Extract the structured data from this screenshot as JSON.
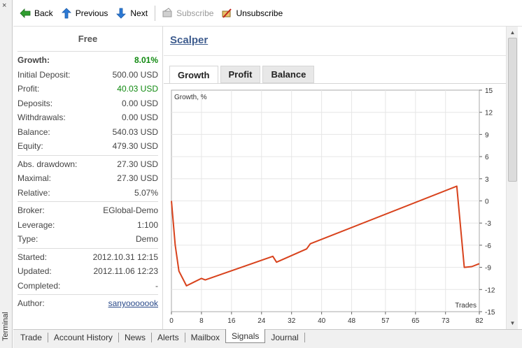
{
  "window": {
    "side_label": "Terminal",
    "close_glyph": "×"
  },
  "toolbar": {
    "back": "Back",
    "previous": "Previous",
    "next": "Next",
    "subscribe": "Subscribe",
    "unsubscribe": "Unsubscribe"
  },
  "stats": {
    "header": "Free",
    "groups": [
      [
        {
          "label": "Growth:",
          "value": "8.01%"
        },
        {
          "label": "Initial Deposit:",
          "value": "500.00 USD"
        },
        {
          "label": "Profit:",
          "value": "40.03 USD"
        },
        {
          "label": "Deposits:",
          "value": "0.00 USD"
        },
        {
          "label": "Withdrawals:",
          "value": "0.00 USD"
        },
        {
          "label": "Balance:",
          "value": "540.03 USD"
        },
        {
          "label": "Equity:",
          "value": "479.30 USD"
        }
      ],
      [
        {
          "label": "Abs. drawdown:",
          "value": "27.30 USD"
        },
        {
          "label": "Maximal:",
          "value": "27.30 USD"
        },
        {
          "label": "Relative:",
          "value": "5.07%"
        }
      ],
      [
        {
          "label": "Broker:",
          "value": "EGlobal-Demo"
        },
        {
          "label": "Leverage:",
          "value": "1:100"
        },
        {
          "label": "Type:",
          "value": "Demo"
        }
      ],
      [
        {
          "label": "Started:",
          "value": "2012.10.31 12:15"
        },
        {
          "label": "Updated:",
          "value": "2012.11.06 12:23"
        },
        {
          "label": "Completed:",
          "value": "-"
        }
      ],
      [
        {
          "label": "Author:",
          "value": "sanyooooook"
        }
      ]
    ]
  },
  "signal": {
    "title": "Scalper"
  },
  "tabs": [
    "Growth",
    "Profit",
    "Balance"
  ],
  "bottom_tabs": [
    "Trade",
    "Account History",
    "News",
    "Alerts",
    "Mailbox",
    "Signals",
    "Journal"
  ],
  "colors": {
    "line": "#d8421c",
    "positive": "#118a11",
    "link": "#3e5c8e"
  },
  "chart_data": {
    "type": "line",
    "title": "Growth, %",
    "xlabel": "Trades",
    "ylabel": "",
    "xlim": [
      0,
      82
    ],
    "ylim": [
      -15,
      15
    ],
    "x_ticks": [
      0,
      8,
      16,
      24,
      32,
      40,
      48,
      57,
      65,
      73,
      82
    ],
    "y_ticks": [
      15,
      12,
      9,
      6,
      3,
      0,
      -3,
      -6,
      -9,
      -12,
      -15
    ],
    "grid": true,
    "series": [
      {
        "x": [
          0,
          1,
          2,
          4,
          6,
          8,
          9,
          27,
          28,
          36,
          37,
          38,
          76,
          78,
          80,
          82
        ],
        "y": [
          0,
          -6,
          -9.5,
          -11.5,
          -11,
          -10.5,
          -10.7,
          -7.5,
          -8.3,
          -6.5,
          -5.8,
          -5.6,
          2,
          -9,
          -8.9,
          -8.5
        ]
      }
    ]
  }
}
